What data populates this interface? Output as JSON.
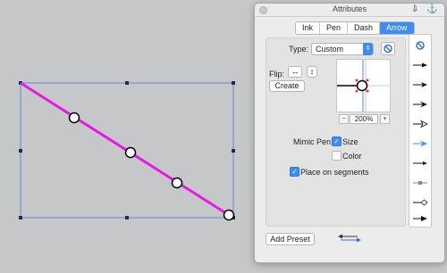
{
  "panel": {
    "title": "Attributes",
    "tabs": [
      {
        "label": "Ink"
      },
      {
        "label": "Pen"
      },
      {
        "label": "Dash"
      },
      {
        "label": "Arrow"
      }
    ],
    "type_label": "Type:",
    "type_value": "Custom",
    "flip_label": "Flip:",
    "flip_horizontal": "↔",
    "flip_vertical": "↕",
    "create_label": "Create",
    "zoom_value": "200%",
    "zoom_out": "−",
    "zoom_in": "+",
    "mimic_pen_label": "Mimic Pen:",
    "mimic_size_label": "Size",
    "mimic_color_label": "Color",
    "place_on_segments_label": "Place on segments",
    "add_preset_label": "Add Preset",
    "checks": {
      "size": true,
      "color": false,
      "place_on_segments": true
    }
  },
  "canvas": {
    "line_color": "#e619e6",
    "selection_color": "#4a7bd0"
  }
}
